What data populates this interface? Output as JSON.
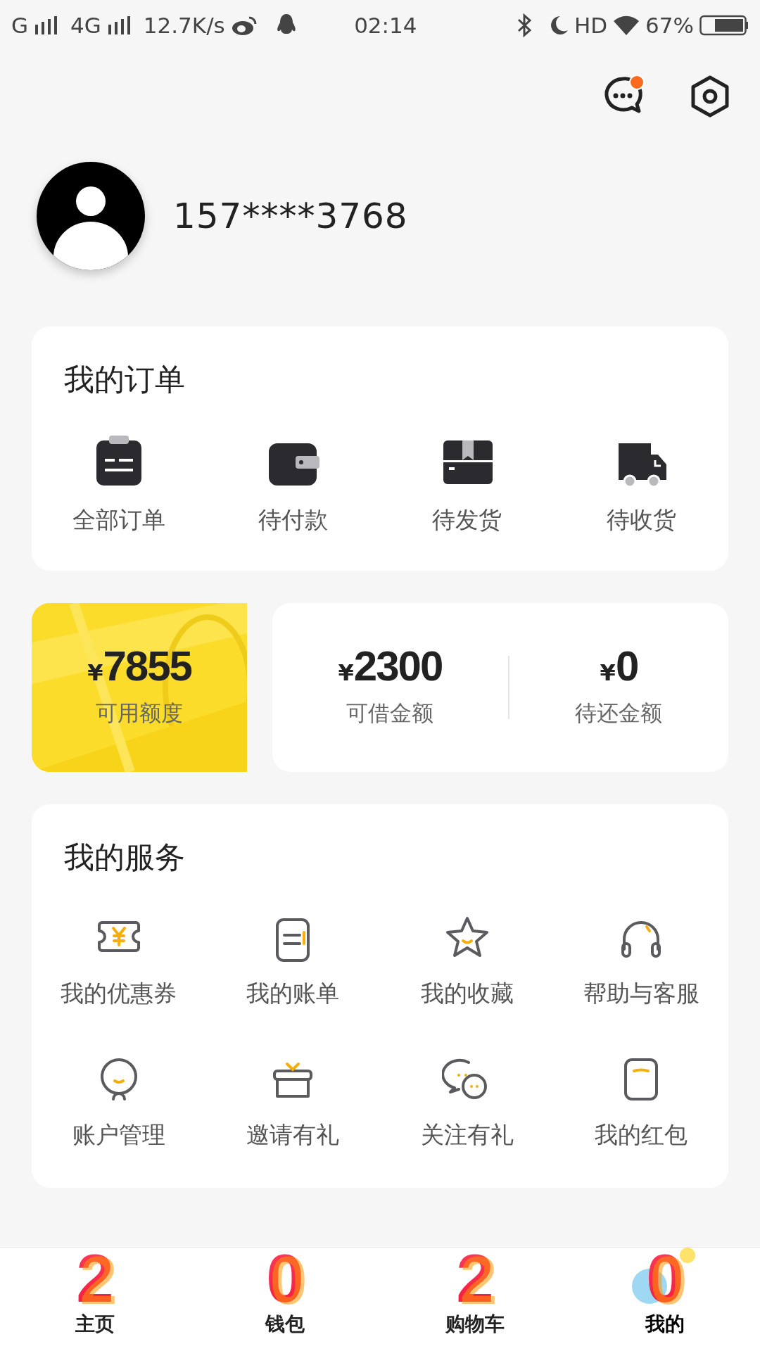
{
  "status_bar": {
    "carrier_1": "G",
    "carrier_2": "4G",
    "speed": "12.7K/s",
    "time": "02:14",
    "hd": "HD",
    "battery": "67%"
  },
  "header": {
    "messages_unread": true
  },
  "profile": {
    "phone": "157****3768"
  },
  "orders": {
    "title": "我的订单",
    "items": [
      {
        "kind": "clipboard",
        "label": "全部订单"
      },
      {
        "kind": "wallet",
        "label": "待付款"
      },
      {
        "kind": "box",
        "label": "待发货"
      },
      {
        "kind": "truck",
        "label": "待收货"
      }
    ]
  },
  "credit": {
    "available": {
      "currency": "¥",
      "amount": "7855",
      "label": "可用额度"
    },
    "items": [
      {
        "currency": "¥",
        "amount": "2300",
        "label": "可借金额"
      },
      {
        "currency": "¥",
        "amount": "0",
        "label": "待还金额"
      }
    ]
  },
  "services": {
    "title": "我的服务",
    "items": [
      {
        "kind": "coupon",
        "label": "我的优惠券"
      },
      {
        "kind": "bill",
        "label": "我的账单"
      },
      {
        "kind": "star",
        "label": "我的收藏"
      },
      {
        "kind": "headset",
        "label": "帮助与客服"
      },
      {
        "kind": "person",
        "label": "账户管理"
      },
      {
        "kind": "gift",
        "label": "邀请有礼"
      },
      {
        "kind": "chat",
        "label": "关注有礼"
      },
      {
        "kind": "packet",
        "label": "我的红包"
      }
    ]
  },
  "tab_bar": [
    {
      "digit": "2",
      "label": "主页",
      "selected": false
    },
    {
      "digit": "0",
      "label": "钱包",
      "selected": false
    },
    {
      "digit": "2",
      "label": "购物车",
      "selected": false
    },
    {
      "digit": "0",
      "label": "我的",
      "selected": true
    }
  ]
}
